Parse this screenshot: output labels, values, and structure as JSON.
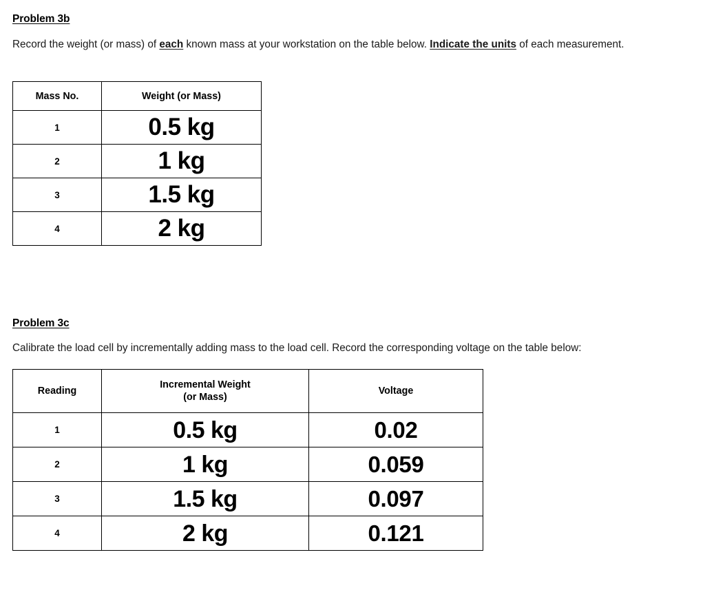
{
  "document": {
    "sections": [
      {
        "heading": "Problem 3b",
        "paragraph": {
          "part1": "Record the weight (or mass) of ",
          "emph1": "each",
          "part2": " known mass at your workstation on the table below. ",
          "emph2": "Indicate the units",
          "part3": " of each measurement."
        },
        "table": {
          "headers": [
            "Mass No.",
            "Weight (or Mass)"
          ],
          "rows": [
            {
              "no": "1",
              "weight": "0.5 kg"
            },
            {
              "no": "2",
              "weight": "1 kg"
            },
            {
              "no": "3",
              "weight": "1.5 kg"
            },
            {
              "no": "4",
              "weight": "2 kg"
            }
          ]
        }
      },
      {
        "heading": "Problem 3c",
        "paragraph": {
          "part1": "Calibrate the load cell by incrementally adding mass to the load cell. Record the corresponding voltage on the table below:"
        },
        "table": {
          "headers": {
            "reading": "Reading",
            "weight_line1": "Incremental Weight",
            "weight_line2": "(or Mass)",
            "voltage": "Voltage"
          },
          "rows": [
            {
              "reading": "1",
              "weight": "0.5 kg",
              "voltage": "0.02"
            },
            {
              "reading": "2",
              "weight": "1 kg",
              "voltage": "0.059"
            },
            {
              "reading": "3",
              "weight": "1.5 kg",
              "voltage": "0.097"
            },
            {
              "reading": "4",
              "weight": "2 kg",
              "voltage": "0.121"
            }
          ]
        }
      }
    ]
  },
  "colors": {
    "text": "#000000",
    "border": "#000000",
    "background": "#ffffff"
  }
}
